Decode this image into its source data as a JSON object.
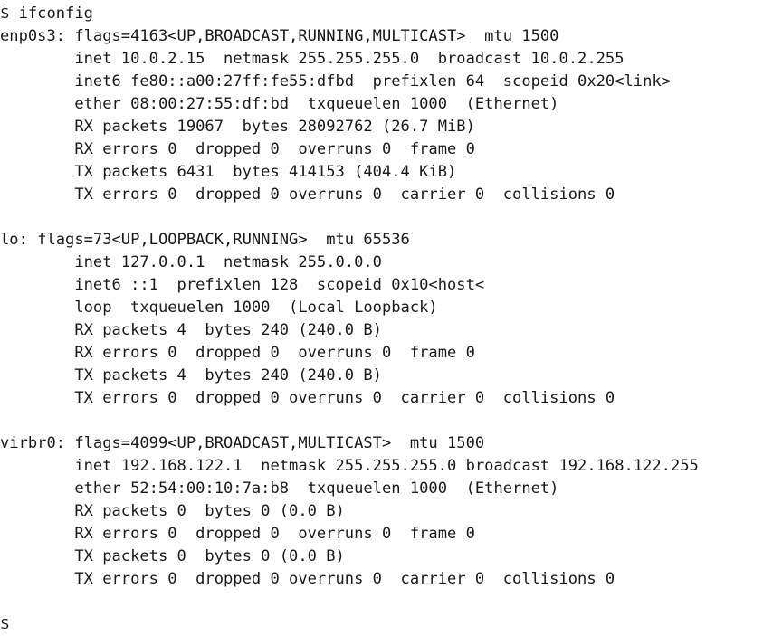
{
  "terminal": {
    "prompt_symbol": "$",
    "command": "ifconfig",
    "background_color": "#ffffff",
    "text_color": "#1a1a1a",
    "lines": [
      "$ ifconfig",
      "enp0s3: flags=4163<UP,BROADCAST,RUNNING,MULTICAST>  mtu 1500",
      "        inet 10.0.2.15  netmask 255.255.255.0  broadcast 10.0.2.255",
      "        inet6 fe80::a00:27ff:fe55:dfbd  prefixlen 64  scopeid 0x20<link>",
      "        ether 08:00:27:55:df:bd  txqueuelen 1000  (Ethernet)",
      "        RX packets 19067  bytes 28092762 (26.7 MiB)",
      "        RX errors 0  dropped 0  overruns 0  frame 0",
      "        TX packets 6431  bytes 414153 (404.4 KiB)",
      "        TX errors 0  dropped 0 overruns 0  carrier 0  collisions 0",
      "",
      "lo: flags=73<UP,LOOPBACK,RUNNING>  mtu 65536",
      "        inet 127.0.0.1  netmask 255.0.0.0",
      "        inet6 ::1  prefixlen 128  scopeid 0x10<host<",
      "        loop  txqueuelen 1000  (Local Loopback)",
      "        RX packets 4  bytes 240 (240.0 B)",
      "        RX errors 0  dropped 0  overruns 0  frame 0",
      "        TX packets 4  bytes 240 (240.0 B)",
      "        TX errors 0  dropped 0 overruns 0  carrier 0  collisions 0",
      "",
      "virbr0: flags=4099<UP,BROADCAST,MULTICAST>  mtu 1500",
      "        inet 192.168.122.1  netmask 255.255.255.0 broadcast 192.168.122.255",
      "        ether 52:54:00:10:7a:b8  txqueuelen 1000  (Ethernet)",
      "        RX packets 0  bytes 0 (0.0 B)",
      "        RX errors 0  dropped 0  overruns 0  frame 0",
      "        TX packets 0  bytes 0 (0.0 B)",
      "        TX errors 0  dropped 0 overruns 0  carrier 0  collisions 0",
      "",
      "$"
    ],
    "interfaces": [
      {
        "name": "enp0s3",
        "flags_value": "4163",
        "flags": [
          "UP",
          "BROADCAST",
          "RUNNING",
          "MULTICAST"
        ],
        "mtu": "1500",
        "inet": "10.0.2.15",
        "netmask": "255.255.255.0",
        "broadcast": "10.0.2.255",
        "inet6": "fe80::a00:27ff:fe55:dfbd",
        "prefixlen": "64",
        "scopeid": "0x20<link>",
        "ether": "08:00:27:55:df:bd",
        "txqueuelen": "1000",
        "link_type": "(Ethernet)",
        "rx_packets": "19067",
        "rx_bytes": "28092762",
        "rx_bytes_human": "(26.7 MiB)",
        "rx_errors": "0",
        "rx_dropped": "0",
        "rx_overruns": "0",
        "rx_frame": "0",
        "tx_packets": "6431",
        "tx_bytes": "414153",
        "tx_bytes_human": "(404.4 KiB)",
        "tx_errors": "0",
        "tx_dropped": "0",
        "tx_overruns": "0",
        "tx_carrier": "0",
        "tx_collisions": "0"
      },
      {
        "name": "lo",
        "flags_value": "73",
        "flags": [
          "UP",
          "LOOPBACK",
          "RUNNING"
        ],
        "mtu": "65536",
        "inet": "127.0.0.1",
        "netmask": "255.0.0.0",
        "inet6": "::1",
        "prefixlen": "128",
        "scopeid": "0x10<host<",
        "loop": "loop",
        "txqueuelen": "1000",
        "link_type": "(Local Loopback)",
        "rx_packets": "4",
        "rx_bytes": "240",
        "rx_bytes_human": "(240.0 B)",
        "rx_errors": "0",
        "rx_dropped": "0",
        "rx_overruns": "0",
        "rx_frame": "0",
        "tx_packets": "4",
        "tx_bytes": "240",
        "tx_bytes_human": "(240.0 B)",
        "tx_errors": "0",
        "tx_dropped": "0",
        "tx_overruns": "0",
        "tx_carrier": "0",
        "tx_collisions": "0"
      },
      {
        "name": "virbr0",
        "flags_value": "4099",
        "flags": [
          "UP",
          "BROADCAST",
          "MULTICAST"
        ],
        "mtu": "1500",
        "inet": "192.168.122.1",
        "netmask": "255.255.255.0",
        "broadcast": "192.168.122.255",
        "ether": "52:54:00:10:7a:b8",
        "txqueuelen": "1000",
        "link_type": "(Ethernet)",
        "rx_packets": "0",
        "rx_bytes": "0",
        "rx_bytes_human": "(0.0 B)",
        "rx_errors": "0",
        "rx_dropped": "0",
        "rx_overruns": "0",
        "rx_frame": "0",
        "tx_packets": "0",
        "tx_bytes": "0",
        "tx_bytes_human": "(0.0 B)",
        "tx_errors": "0",
        "tx_dropped": "0",
        "tx_overruns": "0",
        "tx_carrier": "0",
        "tx_collisions": "0"
      }
    ]
  }
}
